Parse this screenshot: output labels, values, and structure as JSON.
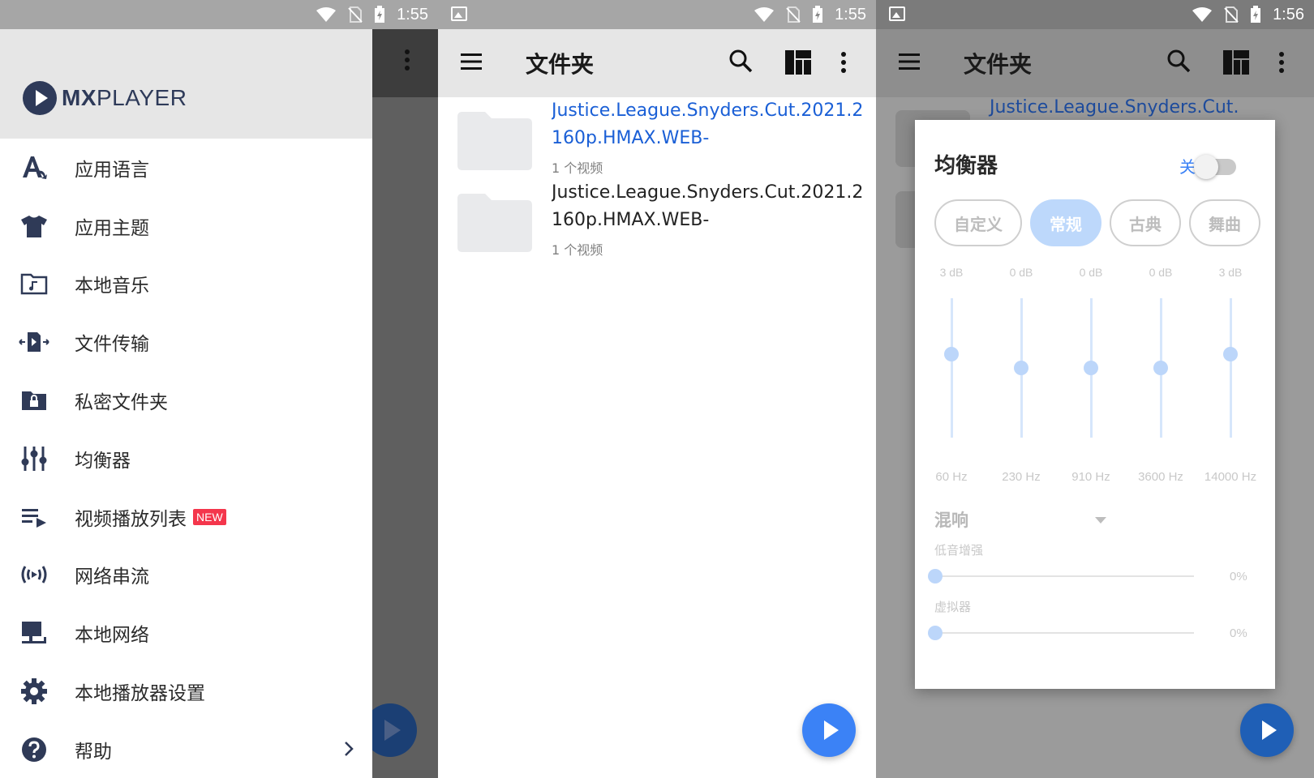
{
  "statusbars": [
    {
      "time": "1:55"
    },
    {
      "time": "1:55"
    },
    {
      "time": "1:56"
    }
  ],
  "drawer": {
    "logo_bold": "MX",
    "logo_rest": "PLAYER",
    "items": [
      {
        "label": "应用语言",
        "icon": "translate-icon"
      },
      {
        "label": "应用主题",
        "icon": "shirt-icon"
      },
      {
        "label": "本地音乐",
        "icon": "music-folder-icon"
      },
      {
        "label": "文件传输",
        "icon": "file-transfer-icon"
      },
      {
        "label": "私密文件夹",
        "icon": "lock-folder-icon"
      },
      {
        "label": "均衡器",
        "icon": "equalizer-icon"
      },
      {
        "label": "视频播放列表",
        "icon": "playlist-icon",
        "badge": "NEW"
      },
      {
        "label": "网络串流",
        "icon": "stream-icon"
      },
      {
        "label": "本地网络",
        "icon": "network-icon"
      },
      {
        "label": "本地播放器设置",
        "icon": "gear-icon"
      },
      {
        "label": "帮助",
        "icon": "help-icon"
      }
    ]
  },
  "folders_screen": {
    "title": "文件夹",
    "folders": [
      {
        "name": "Justice.League.Snyders.Cut.2021.2160p.HMAX.WEB-",
        "count": "1 个视频",
        "color": "#1a5fd6"
      },
      {
        "name": "Justice.League.Snyders.Cut.2021.2160p.HMAX.WEB-",
        "count": "1 个视频",
        "color": "#222222"
      }
    ]
  },
  "equalizer_screen": {
    "title": "文件夹",
    "bg_folder_name": "Justice.League.Snyders.Cut.",
    "dialog": {
      "title": "均衡器",
      "switch_label": "关",
      "switch_on": false,
      "presets": [
        {
          "label": "自定义",
          "active": false
        },
        {
          "label": "常规",
          "active": true
        },
        {
          "label": "古典",
          "active": false
        },
        {
          "label": "舞曲",
          "active": false
        }
      ],
      "bands": [
        {
          "db": "3 dB",
          "hz": "60 Hz",
          "gain": 3
        },
        {
          "db": "0 dB",
          "hz": "230 Hz",
          "gain": 0
        },
        {
          "db": "0 dB",
          "hz": "910 Hz",
          "gain": 0
        },
        {
          "db": "0 dB",
          "hz": "3600 Hz",
          "gain": 0
        },
        {
          "db": "3 dB",
          "hz": "14000 Hz",
          "gain": 3
        }
      ],
      "reverb_label": "混响",
      "bass_label": "低音增强",
      "bass_value": "0%",
      "virtualizer_label": "虚拟器",
      "virtualizer_value": "0%"
    }
  },
  "colors": {
    "accent": "#3b82f6",
    "logo": "#2e3a59",
    "badge": "#f4364c"
  }
}
